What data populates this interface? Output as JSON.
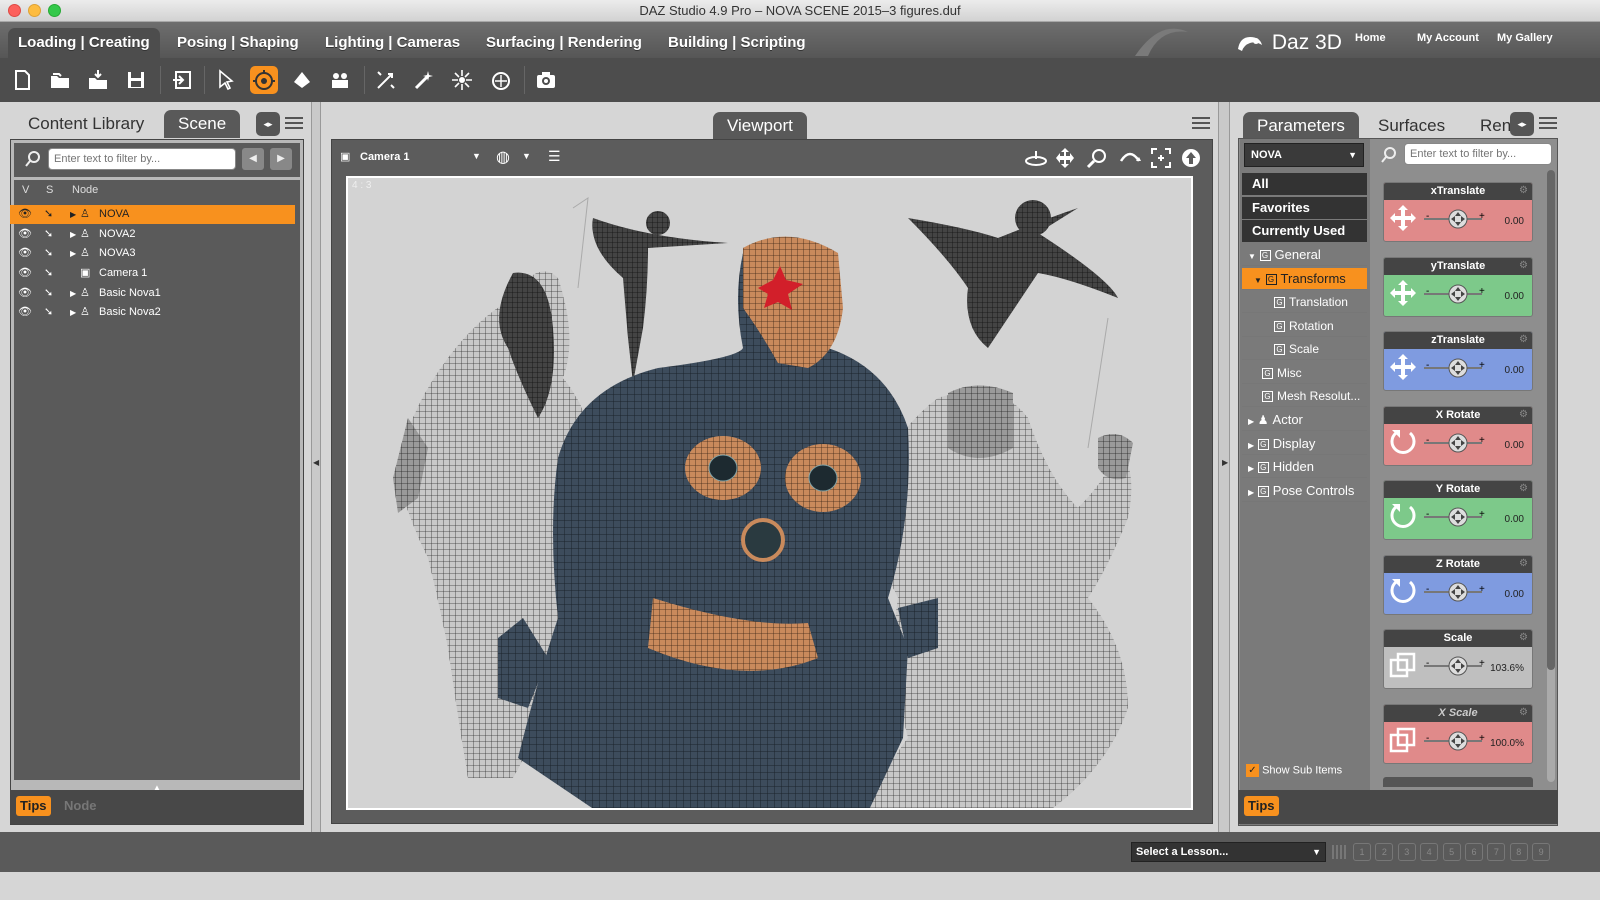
{
  "window": {
    "title": "DAZ Studio 4.9 Pro – NOVA SCENE 2015–3 figures.duf"
  },
  "menu": {
    "tabs": [
      "Loading | Creating",
      "Posing | Shaping",
      "Lighting | Cameras",
      "Surfacing | Rendering",
      "Building | Scripting"
    ],
    "brand": "Daz 3D",
    "links": [
      "Home",
      "My Account",
      "My Gallery"
    ]
  },
  "toolbar": {
    "icons": [
      "new-icon",
      "open-icon",
      "merge-icon",
      "save-icon",
      "undo-icon",
      "select-icon",
      "universal-tool-icon",
      "active-pose-icon",
      "node-weight-icon",
      "spot-render-icon",
      "light-icon",
      "point-light-icon",
      "surface-selection-icon",
      "camera-icon"
    ]
  },
  "left_panel": {
    "tabs": [
      "Content Library",
      "Scene"
    ],
    "filter_placeholder": "Enter text to filter by...",
    "columns": [
      "V",
      "S",
      "Node"
    ],
    "rows": [
      "NOVA",
      "NOVA2",
      "NOVA3",
      "Camera 1",
      "Basic Nova1",
      "Basic Nova2"
    ],
    "bottom": [
      "Tips",
      "Node"
    ]
  },
  "viewport": {
    "tab": "Viewport",
    "camera": "Camera 1",
    "aspect": "4 : 3",
    "nav_icons": [
      "orbit-icon",
      "pan-icon",
      "zoom-icon",
      "roll-icon",
      "frame-icon",
      "reset-icon"
    ]
  },
  "right_panel": {
    "tabs": [
      "Parameters",
      "Surfaces",
      "Ren"
    ],
    "node_select": "NOVA",
    "filter_placeholder": "Enter text to filter by...",
    "categories": [
      "All",
      "Favorites",
      "Currently Used"
    ],
    "tree": [
      {
        "label": "General",
        "level": 0,
        "expanded": true
      },
      {
        "label": "Transforms",
        "level": 1,
        "selected": true
      },
      {
        "label": "Translation",
        "level": 2
      },
      {
        "label": "Rotation",
        "level": 2
      },
      {
        "label": "Scale",
        "level": 2
      },
      {
        "label": "Misc",
        "level": 1
      },
      {
        "label": "Mesh Resolut...",
        "level": 1
      },
      {
        "label": "Actor",
        "level": 0
      },
      {
        "label": "Display",
        "level": 0
      },
      {
        "label": "Hidden",
        "level": 0
      },
      {
        "label": "Pose Controls",
        "level": 0
      }
    ],
    "show_sub_items": "Show Sub Items",
    "params": [
      {
        "name": "xTranslate",
        "value": "0.00",
        "color": "#e08a8a",
        "icon": "move-icon"
      },
      {
        "name": "yTranslate",
        "value": "0.00",
        "color": "#7dc98a",
        "icon": "move-icon"
      },
      {
        "name": "zTranslate",
        "value": "0.00",
        "color": "#7f9be0",
        "icon": "move-icon"
      },
      {
        "name": "X Rotate",
        "value": "0.00",
        "color": "#e08a8a",
        "icon": "rotate-icon"
      },
      {
        "name": "Y Rotate",
        "value": "0.00",
        "color": "#7dc98a",
        "icon": "rotate-icon"
      },
      {
        "name": "Z Rotate",
        "value": "0.00",
        "color": "#7f9be0",
        "icon": "rotate-icon"
      },
      {
        "name": "Scale",
        "value": "103.6%",
        "color": "#bfbfbf",
        "icon": "scale-icon"
      },
      {
        "name": "X Scale",
        "value": "100.0%",
        "color": "#e08a8a",
        "icon": "scale-icon"
      }
    ],
    "tips": "Tips"
  },
  "status_bar": {
    "lesson": "Select a Lesson...",
    "steps": [
      "1",
      "2",
      "3",
      "4",
      "5",
      "6",
      "7",
      "8",
      "9"
    ]
  }
}
